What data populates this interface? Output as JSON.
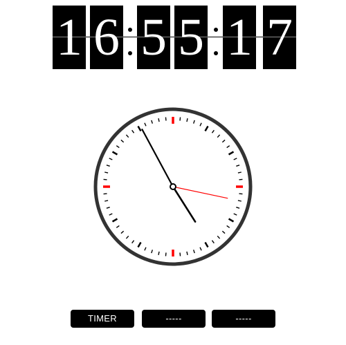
{
  "digital_clock": {
    "digits": [
      "1",
      "6",
      "5",
      "5",
      "1",
      "7"
    ]
  },
  "analog_clock": {
    "hours": 16,
    "minutes": 55,
    "seconds": 17,
    "colors": {
      "rim": "#333333",
      "face": "#ffffff",
      "tick": "#000000",
      "accent_tick": "#ff0000",
      "second_hand": "#ff0000",
      "hand": "#000000"
    }
  },
  "buttons": {
    "timer_label": "TIMER",
    "button2_label": "-----",
    "button3_label": "-----"
  }
}
